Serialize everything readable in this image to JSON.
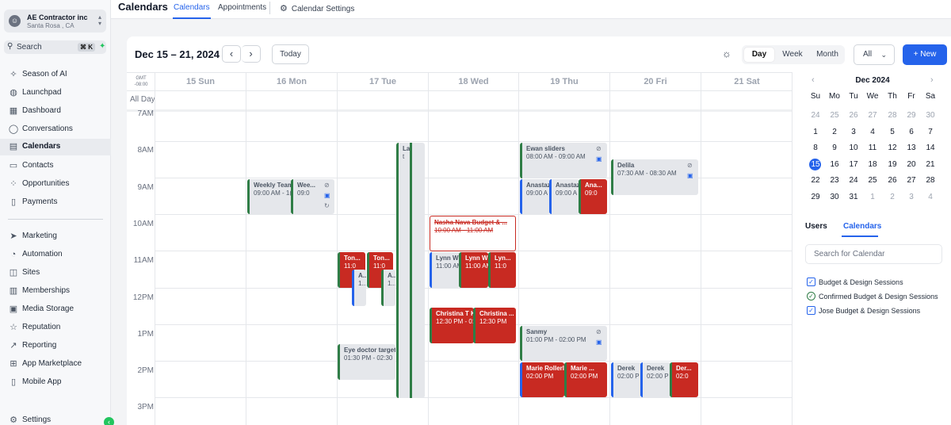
{
  "account": {
    "name": "AE Contractor inc",
    "location": "Santa Rosa , CA"
  },
  "search": {
    "label": "Search",
    "shortcut": "⌘ K"
  },
  "nav": [
    {
      "label": "Season of AI",
      "icon": "sparkle-icon"
    },
    {
      "label": "Launchpad",
      "icon": "rocket-icon"
    },
    {
      "label": "Dashboard",
      "icon": "dashboard-icon"
    },
    {
      "label": "Conversations",
      "icon": "chat-icon"
    },
    {
      "label": "Calendars",
      "icon": "calendar-icon",
      "active": true
    },
    {
      "label": "Contacts",
      "icon": "contacts-icon"
    },
    {
      "label": "Opportunities",
      "icon": "opportunities-icon"
    },
    {
      "label": "Payments",
      "icon": "payments-icon"
    },
    {
      "label": "Marketing",
      "icon": "send-icon"
    },
    {
      "label": "Automation",
      "icon": "automation-icon"
    },
    {
      "label": "Sites",
      "icon": "sites-icon"
    },
    {
      "label": "Memberships",
      "icon": "memberships-icon"
    },
    {
      "label": "Media Storage",
      "icon": "image-icon"
    },
    {
      "label": "Reputation",
      "icon": "star-icon"
    },
    {
      "label": "Reporting",
      "icon": "chart-icon"
    },
    {
      "label": "App Marketplace",
      "icon": "grid-icon"
    },
    {
      "label": "Mobile App",
      "icon": "phone-icon"
    },
    {
      "label": "Settings",
      "icon": "gear-icon"
    }
  ],
  "header": {
    "title": "Calendars",
    "tabs": [
      "Calendars",
      "Appointments",
      "Calendar Settings"
    ]
  },
  "toolbar": {
    "date_range": "Dec 15 – 21, 2024",
    "today": "Today",
    "views": [
      "Day",
      "Week",
      "Month"
    ],
    "active_view": "Day",
    "filter": "All",
    "new": "+ New"
  },
  "grid": {
    "gmt": "GMT -08:00",
    "all_day": "All Day",
    "days": [
      "15 Sun",
      "16 Mon",
      "17 Tue",
      "18 Wed",
      "19 Thu",
      "20 Fri",
      "21 Sat"
    ],
    "hours": [
      "7AM",
      "8AM",
      "9AM",
      "10AM",
      "11AM",
      "12PM",
      "1PM",
      "2PM",
      "3PM"
    ]
  },
  "events": [
    {
      "title": "Weekly Team",
      "time": "09:00 AM - 1("
    },
    {
      "title": "Wee...",
      "time": "09:0"
    },
    {
      "title": "Ton...",
      "time": "11:0"
    },
    {
      "title": "Ton...",
      "time": "11:0"
    },
    {
      "title": "A...",
      "time": "1..."
    },
    {
      "title": "A...",
      "time": "1..."
    },
    {
      "title": "La",
      "time": "t"
    },
    {
      "title": "Eye doctor target",
      "time": "01:30 PM - 02:30"
    },
    {
      "title": "Nasha Nava Budget & ...",
      "time": "10:00 AM - 11:00 AM"
    },
    {
      "title": "Lynn Wi",
      "time": "11:00 AM"
    },
    {
      "title": "Lynn Wil",
      "time": "11:00 AM"
    },
    {
      "title": "Lyn...",
      "time": "11:0"
    },
    {
      "title": "Christina T K",
      "time": "12:30 PM - 01"
    },
    {
      "title": "Christina ...",
      "time": "12:30 PM"
    },
    {
      "title": "Ewan sliders",
      "time": "08:00 AM - 09:00 AM"
    },
    {
      "title": "Anastaz",
      "time": "09:00 A"
    },
    {
      "title": "Anastaz",
      "time": "09:00 A"
    },
    {
      "title": "Ana...",
      "time": "09:0"
    },
    {
      "title": "Sanmy",
      "time": "01:00 PM - 02:00 PM"
    },
    {
      "title": "Marie Rollerl",
      "time": "02:00 PM"
    },
    {
      "title": "Marie ...",
      "time": "02:00 PM"
    },
    {
      "title": "Delila",
      "time": "07:30 AM - 08:30 AM"
    },
    {
      "title": "Derek",
      "time": "02:00 P"
    },
    {
      "title": "Derek",
      "time": "02:00 P"
    },
    {
      "title": "Der...",
      "time": "02:0"
    }
  ],
  "minical": {
    "title": "Dec 2024",
    "dow": [
      "Su",
      "Mo",
      "Tu",
      "We",
      "Th",
      "Fr",
      "Sa"
    ],
    "weeks": [
      [
        "24",
        "25",
        "26",
        "27",
        "28",
        "29",
        "30"
      ],
      [
        "1",
        "2",
        "3",
        "4",
        "5",
        "6",
        "7"
      ],
      [
        "8",
        "9",
        "10",
        "11",
        "12",
        "13",
        "14"
      ],
      [
        "15",
        "16",
        "17",
        "18",
        "19",
        "20",
        "21"
      ],
      [
        "22",
        "23",
        "24",
        "25",
        "26",
        "27",
        "28"
      ],
      [
        "29",
        "30",
        "31",
        "1",
        "2",
        "3",
        "4"
      ]
    ],
    "selected": "15"
  },
  "right": {
    "tabs": [
      "Users",
      "Calendars"
    ],
    "search_placeholder": "Search for Calendar",
    "calendars": [
      {
        "label": "Budget & Design Sessions",
        "color": "#2563eb"
      },
      {
        "label": "Confirmed Budget & Design Sessions",
        "color": "#2f7d46"
      },
      {
        "label": "Jose Budget & Design Sessions",
        "color": "#2563eb"
      }
    ]
  }
}
